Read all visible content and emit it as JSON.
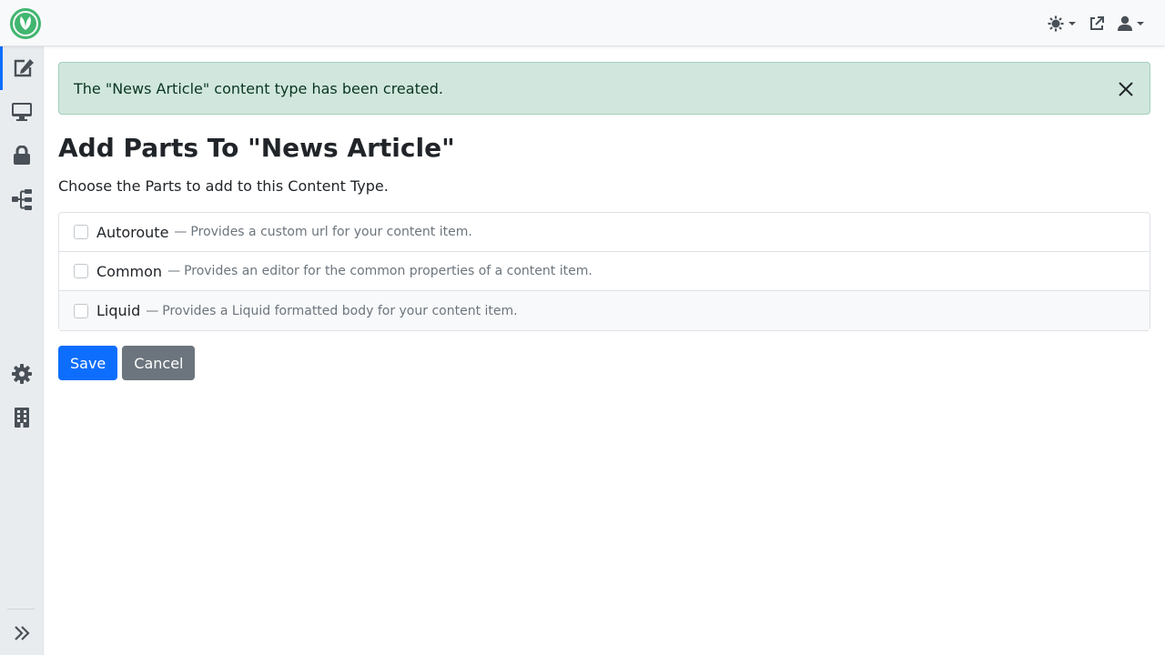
{
  "alert": {
    "message": "The \"News Article\" content type has been created."
  },
  "page": {
    "title": "Add Parts To \"News Article\"",
    "subtitle": "Choose the Parts to add to this Content Type."
  },
  "parts": [
    {
      "name": "Autoroute",
      "separator": "—",
      "description": "Provides a custom url for your content item.",
      "checked": false
    },
    {
      "name": "Common",
      "separator": "—",
      "description": "Provides an editor for the common properties of a content item.",
      "checked": false
    },
    {
      "name": "Liquid",
      "separator": "—",
      "description": "Provides a Liquid formatted body for your content item.",
      "checked": false
    }
  ],
  "buttons": {
    "save": "Save",
    "cancel": "Cancel"
  },
  "colors": {
    "primary": "#0d6efd",
    "secondary": "#6c757d",
    "alert_bg": "#d1e7dd",
    "logo": "#41b670"
  },
  "icons": {
    "topbar": [
      "theme-toggle-icon",
      "external-link-icon",
      "user-icon"
    ],
    "sidebar": [
      "edit-icon",
      "desktop-icon",
      "lock-icon",
      "sitemap-icon",
      "gear-icon",
      "building-icon",
      "expand-icon"
    ]
  }
}
